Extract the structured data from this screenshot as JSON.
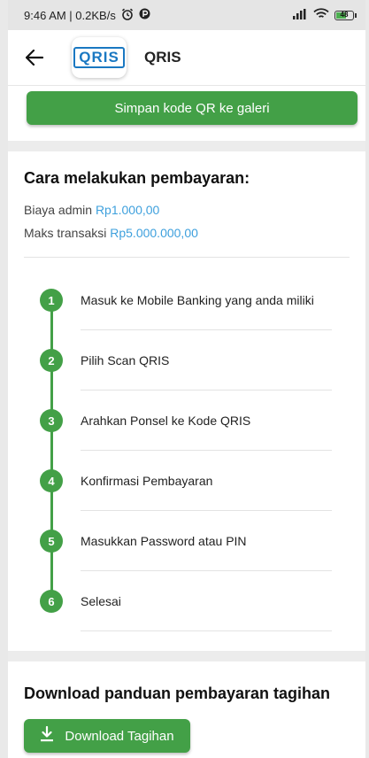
{
  "status_bar": {
    "time_speed": "9:46 AM | 0.2KB/s",
    "battery_level": "48"
  },
  "appbar": {
    "logo_text": "QRIS",
    "title": "QRIS"
  },
  "save_button": "Simpan kode QR ke galeri",
  "payment": {
    "heading": "Cara melakukan pembayaran:",
    "admin_label": "Biaya admin",
    "admin_value": "Rp1.000,00",
    "max_label": "Maks transaksi",
    "max_value": "Rp5.000.000,00",
    "steps": [
      {
        "num": "1",
        "label": "Masuk ke Mobile Banking yang anda miliki"
      },
      {
        "num": "2",
        "label": "Pilih Scan QRIS"
      },
      {
        "num": "3",
        "label": "Arahkan Ponsel ke Kode QRIS"
      },
      {
        "num": "4",
        "label": "Konfirmasi Pembayaran"
      },
      {
        "num": "5",
        "label": "Masukkan Password atau PIN"
      },
      {
        "num": "6",
        "label": "Selesai"
      }
    ]
  },
  "download": {
    "heading": "Download panduan pembayaran tagihan",
    "button": "Download Tagihan"
  },
  "colors": {
    "accent": "#43a047",
    "link": "#3ea0dd",
    "brand": "#1a78c2"
  },
  "icons": [
    "alarm-icon",
    "app-status-icon",
    "signal-icon",
    "wifi-icon",
    "battery-icon",
    "back-arrow-icon",
    "download-icon"
  ]
}
